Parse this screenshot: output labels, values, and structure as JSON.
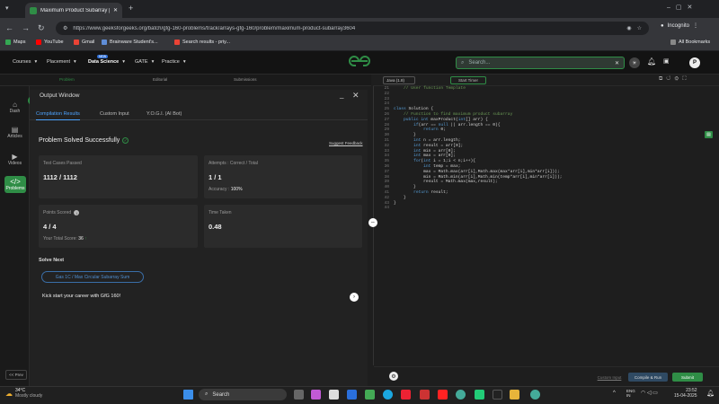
{
  "browser": {
    "tab_title": "Maximum Product Subarray | P",
    "url": "https://www.geeksforgeeks.org/batch/gfg-160-problems/track/arrays-gfg-160/problem/maximum-product-subarray3604",
    "profile_label": "Incognito",
    "bookmarks": [
      "Maps",
      "YouTube",
      "Gmail",
      "Brainware Student's...",
      "Search results - priy..."
    ],
    "all_bookmarks_label": "All Bookmarks"
  },
  "site": {
    "nav": [
      "Courses",
      "Placement",
      "Data Science",
      "GATE",
      "Practice"
    ],
    "new_badge": "NEW",
    "logo": "GfG",
    "search_placeholder": "Search...",
    "avatar_letter": "P"
  },
  "subtabs": {
    "problem": "Problem",
    "editorial": "Editorial",
    "submissions": "Submissions"
  },
  "editor_bar": {
    "language": "Java (1.8)",
    "timer": "Start Timer"
  },
  "rail": {
    "items": [
      "Dash",
      "Articles",
      "Videos",
      "Problems"
    ],
    "prev": "<< Prev"
  },
  "output": {
    "title": "Output Window",
    "tabs": [
      "Compilation Results",
      "Custom Input",
      "Y.O.G.I. (AI Bot)"
    ],
    "status": "Problem Solved Successfully",
    "report": "Suggest Feedback",
    "cards": {
      "test_cases_label": "Test Cases Passed",
      "test_cases_value": "1112 / 1112",
      "attempts_label": "Attempts : Correct / Total",
      "attempts_value": "1 / 1",
      "accuracy_label": "Accuracy :",
      "accuracy_value": "100%",
      "points_label": "Points Scored",
      "points_value": "4 / 4",
      "total_score_label": "Your Total Score:",
      "total_score_value": "36",
      "time_label": "Time Taken",
      "time_value": "0.48"
    },
    "solve_next": "Solve Next",
    "next_problem": "Gas 1C / Max Circular Subarray Sum",
    "kickstart": "Kick start your career with GfG 160!"
  },
  "code": {
    "line_numbers": [
      "21",
      "22",
      "23",
      "24",
      "25",
      "26",
      "27",
      "28",
      "29",
      "30",
      "31",
      "32",
      "33",
      "34",
      "35",
      "36",
      "37",
      "38",
      "39",
      "40",
      "41",
      "42",
      "43",
      "44"
    ],
    "lines": [
      "    // User function Template",
      "",
      "",
      "",
      "class Solution {",
      "    // Function to find maximum product subarray",
      "    public int maxProduct(int[] arr) {",
      "        if(arr == null || arr.length == 0){",
      "            return 0;",
      "        }",
      "        int n = arr.length;",
      "        int result = arr[0];",
      "        int min = arr[0];",
      "        int max = arr[0];",
      "        for(int i = 1;i < n;i++){",
      "            int temp = max;",
      "            max = Math.max(arr[i],Math.max(max*arr[i],min*arr[i]));",
      "            min = Math.min(arr[i],Math.min(temp*arr[i],min*arr[i]));",
      "            result = Math.max(max,result);",
      "        }",
      "        return result;",
      "    }",
      "}",
      ""
    ]
  },
  "editor_footer": {
    "custom_input": "Custom Input",
    "compile": "Compile & Run",
    "submit": "Submit"
  },
  "taskbar": {
    "weather_temp": "34°C",
    "weather_desc": "Mostly cloudy",
    "search": "Search",
    "lang": "ENG",
    "region": "IN",
    "time": "23:52",
    "date": "15-04-2025"
  },
  "colors": {
    "accent_green": "#2f8d46",
    "link_blue": "#4ca3ff"
  }
}
